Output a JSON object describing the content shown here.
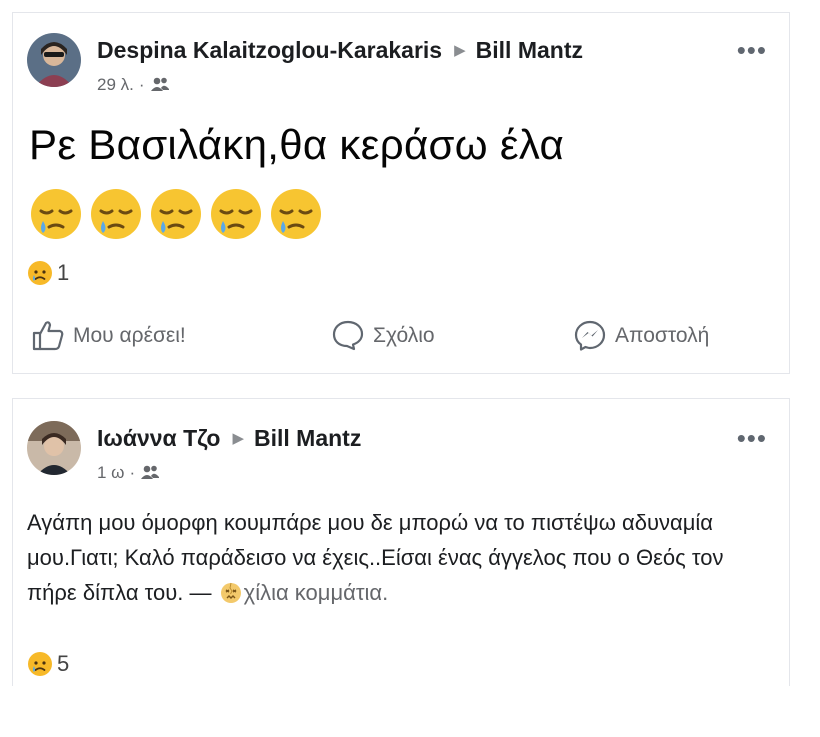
{
  "posts": [
    {
      "author": "Despina Kalaitzoglou-Karakaris",
      "recipient": "Bill Mantz",
      "time": "29 λ.",
      "audience_icon": "friends-icon",
      "text": "Ρε Βασιλάκη,θα κεράσω έλα",
      "emojis": [
        "sleepy-face-icon",
        "sleepy-face-icon",
        "sleepy-face-icon",
        "sleepy-face-icon",
        "sleepy-face-icon"
      ],
      "reaction_icon": "sad-reaction-icon",
      "reaction_count": "1",
      "actions": {
        "like": "Μου αρέσει!",
        "comment": "Σχόλιο",
        "send": "Αποστολή"
      },
      "more_label": "•••"
    },
    {
      "author": "Ιωάννα Τζο",
      "recipient": "Bill Mantz",
      "time": "1 ω",
      "audience_icon": "friends-icon",
      "text": "Αγάπη μου όμορφη κουμπάρε μου δε μπορώ να το πιστέψω αδυναμία μου.Γιατι; Καλό παράδεισο να έχεις..Είσαι ένας άγγελος που ο Θεός τον πήρε δίπλα του.",
      "feeling_dash": " — ",
      "feeling_icon": "broken-pieces-face-icon",
      "feeling": "χίλια κομμάτια.",
      "reaction_icon": "sad-reaction-icon",
      "reaction_count": "5",
      "more_label": "•••"
    }
  ],
  "separator": "·",
  "arrow": "▶",
  "colors": {
    "name_text": "#1c1e21",
    "meta_text": "#65676b",
    "emoji_yellow": "#f7c531",
    "tear_blue": "#5aa9e6"
  }
}
